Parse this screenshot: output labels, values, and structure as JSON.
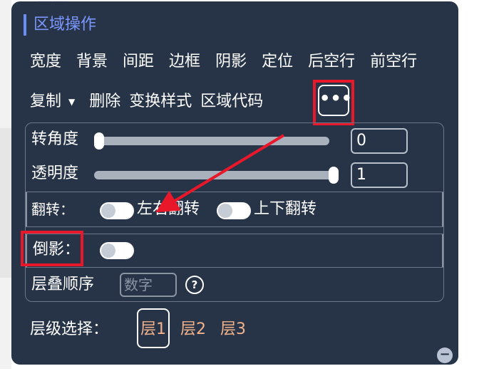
{
  "panel": {
    "title": "区域操作"
  },
  "menu": {
    "row1": [
      "宽度",
      "背景",
      "间距",
      "边框",
      "阴影",
      "定位",
      "后空行",
      "前空行"
    ],
    "copy": "复制",
    "delete": "删除",
    "transform": "变换样式",
    "code": "区域代码",
    "more": "•••"
  },
  "rotate": {
    "label": "转角度",
    "value": "0"
  },
  "opacity": {
    "label": "透明度",
    "value": "1"
  },
  "flip": {
    "label": "翻转：",
    "horizontal": "左右翻转",
    "vertical": "上下翻转"
  },
  "reflection": {
    "label": "倒影："
  },
  "zorder": {
    "label": "层叠顺序",
    "placeholder": "数字",
    "help": "?"
  },
  "layer": {
    "label": "层级选择：",
    "options": [
      "层1",
      "层2",
      "层3"
    ]
  },
  "colors": {
    "panel_bg": "#273448",
    "accent": "#7b97ff",
    "highlight": "#e8182a",
    "layer_text": "#f2b28a"
  },
  "icons": {
    "more": "ellipsis-icon",
    "caret": "caret-down-icon",
    "help": "question-circle-icon",
    "minus": "minus-circle-icon"
  }
}
